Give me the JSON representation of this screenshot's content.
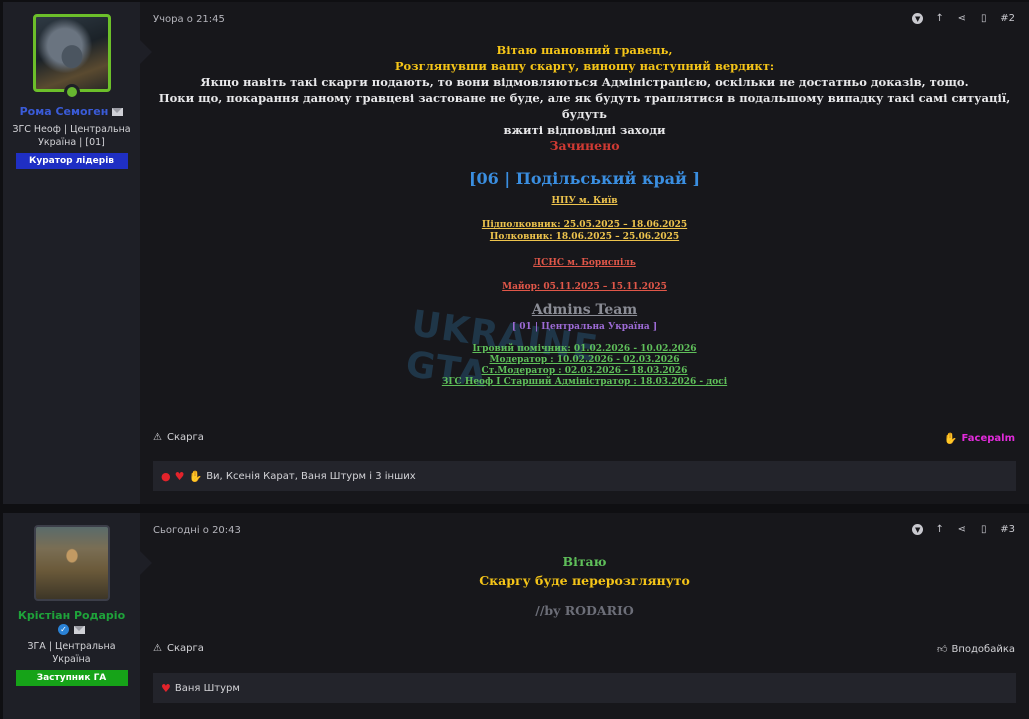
{
  "post1": {
    "username": "Рома Семоген",
    "user_title": "ЗГС Неоф | Центральна Україна | [01]",
    "badge": "Куратор лідерів",
    "time": "Учора о 21:45",
    "post_number": "#2",
    "lines": {
      "greet": "Вітаю шановний гравець,",
      "verdict": "Розглянувши вашу скаргу, виношу наступний вердикт:",
      "p1": "Якщо навіть такі скарги подають, то вони відмовляються Адміністрацією, оскільки не достатньо доказів, тощо.",
      "p2a": "Поки що, покарання даному гравцеві застоване не буде, але як будуть траплятися в подальшому випадку такі самі ситуації, будуть",
      "p2b": "вжиті відповідні заходи",
      "closed": "Зачинено"
    },
    "signature": {
      "server": "[06 | Подільський край ]",
      "npu": "НПУ м. Київ",
      "pidpolk": "Підполковник: 25.05.2025 – 18.06.2025",
      "polk": "Полковник: 18.06.2025 – 25.06.2025",
      "dsns": "ДСНС м. Бориспіль",
      "major": "Майор: 05.11.2025 – 15.11.2025",
      "admins": "Admins Team",
      "region": "[ 01 | Центральна Україна ]",
      "helper": "Ігровий помічник: 01.02.2026 - 10.02.2026",
      "moder": "Модератор : 10.02.2026 - 02.03.2026",
      "stmoder": "Ст.Модератор : 02.03.2026 - 18.03.2026",
      "zgs": "ЗГС Неоф I Старший Адміністратор : 18.03.2026 - досі"
    },
    "watermark": "UKRAINE GTA",
    "report_label": "Скарга",
    "reaction_given": "Facepalm",
    "reactions_text": "Ви, Ксенія Карат, Ваня Штурм і 3 інших"
  },
  "post2": {
    "username": "Крістіан Родаріо",
    "user_title": "ЗГА | Центральна Україна",
    "badge": "Заступник ГА",
    "time": "Сьогодні о 20:43",
    "post_number": "#3",
    "lines": {
      "greet": "Вітаю",
      "msg": "Скаргу буде перерозглянуто",
      "sig": "//by RODARIO"
    },
    "report_label": "Скарга",
    "like_label": "Вподобайка",
    "reactions_text": "Ваня Штурм"
  },
  "colors": {
    "accent_yellow": "#f5c518",
    "accent_green": "#16a318",
    "accent_blue_badge": "#1f2fc4",
    "reaction_pink": "#e22bdb"
  }
}
